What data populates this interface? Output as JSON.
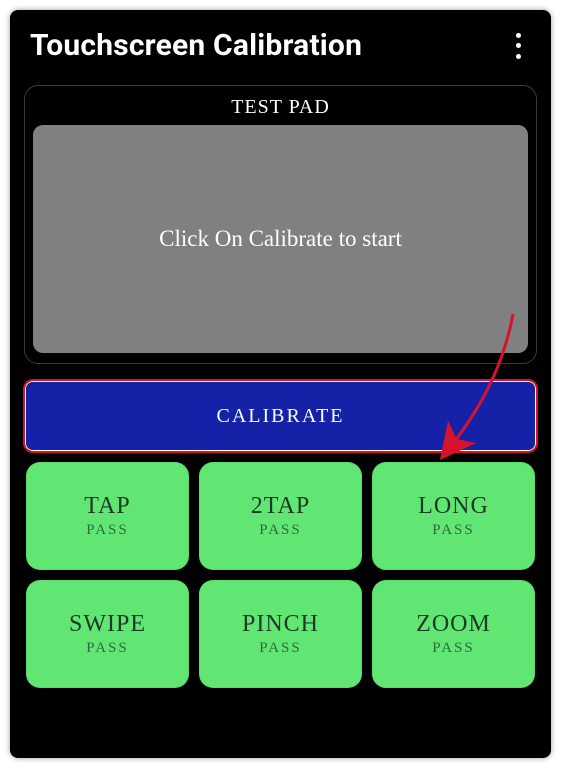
{
  "header": {
    "title": "Touchscreen Calibration"
  },
  "testpad": {
    "label": "TEST PAD",
    "message": "Click On Calibrate to start"
  },
  "calibrate": {
    "label": "CALIBRATE"
  },
  "tests": [
    {
      "name": "TAP",
      "status": "PASS"
    },
    {
      "name": "2TAP",
      "status": "PASS"
    },
    {
      "name": "LONG",
      "status": "PASS"
    },
    {
      "name": "SWIPE",
      "status": "PASS"
    },
    {
      "name": "PINCH",
      "status": "PASS"
    },
    {
      "name": "ZOOM",
      "status": "PASS"
    }
  ],
  "colors": {
    "accent": "#1522a7",
    "pass_tile": "#61e674",
    "highlight": "#d6132a"
  }
}
